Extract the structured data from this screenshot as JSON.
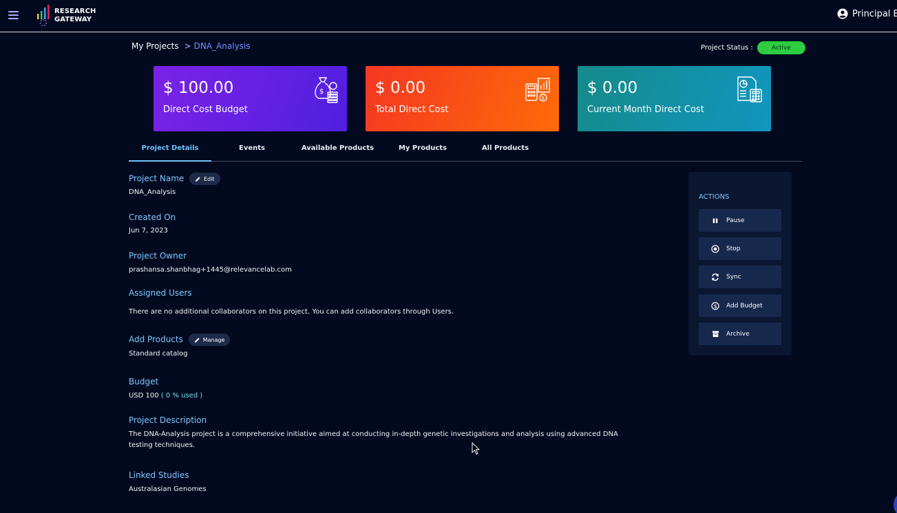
{
  "header": {
    "logo_line1": "RESEARCH",
    "logo_line2": "GATEWAY",
    "user_name": "Principal B"
  },
  "breadcrumb": {
    "root": "My Projects",
    "separator": ">",
    "current": "DNA_Analysis"
  },
  "project_status": {
    "label": "Project Status :",
    "value": "Active"
  },
  "cards": [
    {
      "amount": "$ 100.00",
      "label": "Direct Cost Budget",
      "icon": "money-bag-icon"
    },
    {
      "amount": "$ 0.00",
      "label": "Total Direct Cost",
      "icon": "calculator-chart-icon"
    },
    {
      "amount": "$ 0.00",
      "label": "Current Month Direct Cost",
      "icon": "report-calculator-icon"
    }
  ],
  "tabs": [
    {
      "label": "Project Details",
      "active": true
    },
    {
      "label": "Events",
      "active": false
    },
    {
      "label": "Available Products",
      "active": false
    },
    {
      "label": "My Products",
      "active": false
    },
    {
      "label": "All Products",
      "active": false
    }
  ],
  "details": {
    "project_name_label": "Project Name",
    "edit_label": "Edit",
    "project_name": "DNA_Analysis",
    "created_on_label": "Created On",
    "created_on": "Jun 7, 2023",
    "owner_label": "Project Owner",
    "owner": "prashansa.shanbhag+1445@relevancelab.com",
    "assigned_users_label": "Assigned Users",
    "assigned_users": "There are no additional collaborators on this project. You can add collaborators through Users.",
    "add_products_label": "Add Products",
    "manage_label": "Manage",
    "products": "Standard catalog",
    "budget_label": "Budget",
    "budget": "USD 100",
    "budget_used": "( 0 % used )",
    "description_label": "Project Description",
    "description": "The DNA-Analysis project is a comprehensive initiative aimed at conducting in-depth genetic investigations and analysis using advanced DNA testing techniques.",
    "linked_studies_label": "Linked Studies",
    "linked_studies": "Australasian Genomes"
  },
  "actions": {
    "title": "ACTIONS",
    "buttons": [
      {
        "label": "Pause",
        "icon": "pause-icon"
      },
      {
        "label": "Stop",
        "icon": "stop-icon"
      },
      {
        "label": "Sync",
        "icon": "sync-icon"
      },
      {
        "label": "Add Budget",
        "icon": "dollar-icon"
      },
      {
        "label": "Archive",
        "icon": "archive-icon"
      }
    ]
  },
  "colors": {
    "background": "#030a1f",
    "label_blue": "#7ec8ff",
    "status_green": "#2ecc40"
  }
}
